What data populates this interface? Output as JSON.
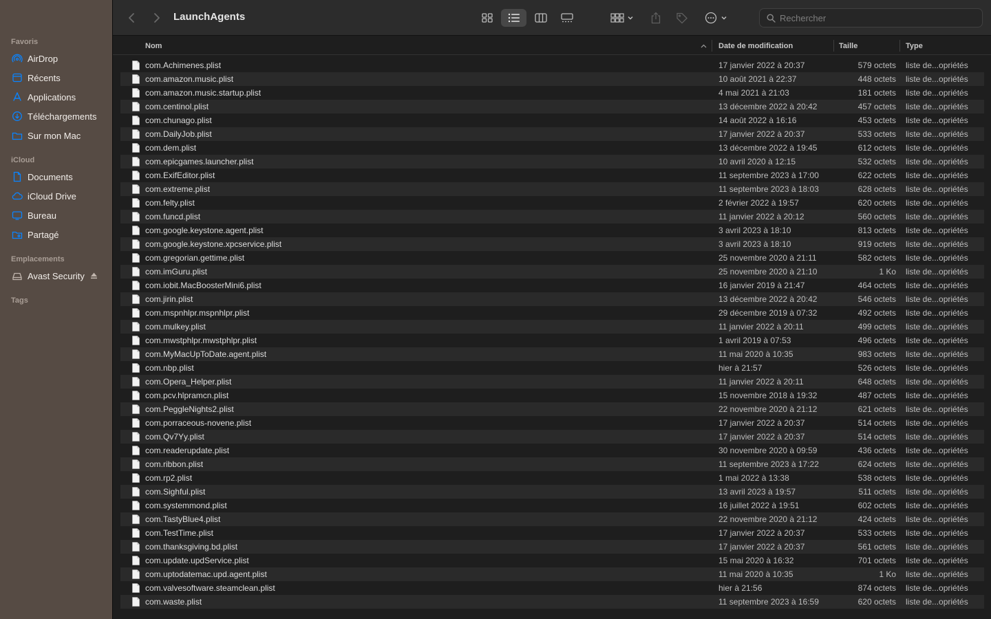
{
  "window": {
    "title": "LaunchAgents"
  },
  "toolbar": {
    "back_icon": "chevron-left-icon",
    "forward_icon": "chevron-right-icon",
    "views": [
      "icon-view",
      "list-view",
      "column-view",
      "gallery-view"
    ],
    "active_view": "list-view"
  },
  "search": {
    "placeholder": "Rechercher",
    "value": ""
  },
  "sidebar": {
    "sections": [
      {
        "label": "Favoris",
        "items": [
          {
            "label": "AirDrop",
            "icon": "airdrop-icon"
          },
          {
            "label": "Récents",
            "icon": "recents-icon"
          },
          {
            "label": "Applications",
            "icon": "applications-icon"
          },
          {
            "label": "Téléchargements",
            "icon": "downloads-icon"
          },
          {
            "label": "Sur mon Mac",
            "icon": "folder-icon"
          }
        ]
      },
      {
        "label": "iCloud",
        "items": [
          {
            "label": "Documents",
            "icon": "document-icon"
          },
          {
            "label": "iCloud Drive",
            "icon": "cloud-icon"
          },
          {
            "label": "Bureau",
            "icon": "desktop-icon"
          },
          {
            "label": "Partagé",
            "icon": "shared-folder-icon"
          }
        ]
      },
      {
        "label": "Emplacements",
        "items": [
          {
            "label": "Avast Security",
            "icon": "disk-icon"
          }
        ]
      },
      {
        "label": "Tags",
        "items": []
      }
    ]
  },
  "columns": {
    "name": "Nom",
    "date": "Date de modification",
    "size": "Taille",
    "type": "Type"
  },
  "colors": {
    "sidebar_bg": "#564b44",
    "accent": "#0a84ff"
  },
  "files": [
    {
      "name": "com.Achimenes.plist",
      "date": "17 janvier 2022 à 20:37",
      "size": "579 octets",
      "type": "liste de...opriétés"
    },
    {
      "name": "com.amazon.music.plist",
      "date": "10 août 2021 à 22:37",
      "size": "448 octets",
      "type": "liste de...opriétés"
    },
    {
      "name": "com.amazon.music.startup.plist",
      "date": "4 mai 2021 à 21:03",
      "size": "181 octets",
      "type": "liste de...opriétés"
    },
    {
      "name": "com.centinol.plist",
      "date": "13 décembre 2022 à 20:42",
      "size": "457 octets",
      "type": "liste de...opriétés"
    },
    {
      "name": "com.chunago.plist",
      "date": "14 août 2022 à 16:16",
      "size": "453 octets",
      "type": "liste de...opriétés"
    },
    {
      "name": "com.DailyJob.plist",
      "date": "17 janvier 2022 à 20:37",
      "size": "533 octets",
      "type": "liste de...opriétés"
    },
    {
      "name": "com.dem.plist",
      "date": "13 décembre 2022 à 19:45",
      "size": "612 octets",
      "type": "liste de...opriétés"
    },
    {
      "name": "com.epicgames.launcher.plist",
      "date": "10 avril 2020 à 12:15",
      "size": "532 octets",
      "type": "liste de...opriétés"
    },
    {
      "name": "com.ExifEditor.plist",
      "date": "11 septembre 2023 à 17:00",
      "size": "622 octets",
      "type": "liste de...opriétés"
    },
    {
      "name": "com.extreme.plist",
      "date": "11 septembre 2023 à 18:03",
      "size": "628 octets",
      "type": "liste de...opriétés"
    },
    {
      "name": "com.felty.plist",
      "date": "2 février 2022 à 19:57",
      "size": "620 octets",
      "type": "liste de...opriétés"
    },
    {
      "name": "com.funcd.plist",
      "date": "11 janvier 2022 à 20:12",
      "size": "560 octets",
      "type": "liste de...opriétés"
    },
    {
      "name": "com.google.keystone.agent.plist",
      "date": "3 avril 2023 à 18:10",
      "size": "813 octets",
      "type": "liste de...opriétés"
    },
    {
      "name": "com.google.keystone.xpcservice.plist",
      "date": "3 avril 2023 à 18:10",
      "size": "919 octets",
      "type": "liste de...opriétés"
    },
    {
      "name": "com.gregorian.gettime.plist",
      "date": "25 novembre 2020 à 21:11",
      "size": "582 octets",
      "type": "liste de...opriétés"
    },
    {
      "name": "com.imGuru.plist",
      "date": "25 novembre 2020 à 21:10",
      "size": "1 Ko",
      "type": "liste de...opriétés"
    },
    {
      "name": "com.iobit.MacBoosterMini6.plist",
      "date": "16 janvier 2019 à 21:47",
      "size": "464 octets",
      "type": "liste de...opriétés"
    },
    {
      "name": "com.jirin.plist",
      "date": "13 décembre 2022 à 20:42",
      "size": "546 octets",
      "type": "liste de...opriétés"
    },
    {
      "name": "com.mspnhlpr.mspnhlpr.plist",
      "date": "29 décembre 2019 à 07:32",
      "size": "492 octets",
      "type": "liste de...opriétés"
    },
    {
      "name": "com.mulkey.plist",
      "date": "11 janvier 2022 à 20:11",
      "size": "499 octets",
      "type": "liste de...opriétés"
    },
    {
      "name": "com.mwstphlpr.mwstphlpr.plist",
      "date": "1 avril 2019 à 07:53",
      "size": "496 octets",
      "type": "liste de...opriétés"
    },
    {
      "name": "com.MyMacUpToDate.agent.plist",
      "date": "11 mai 2020 à 10:35",
      "size": "983 octets",
      "type": "liste de...opriétés"
    },
    {
      "name": "com.nbp.plist",
      "date": "hier à 21:57",
      "size": "526 octets",
      "type": "liste de...opriétés"
    },
    {
      "name": "com.Opera_Helper.plist",
      "date": "11 janvier 2022 à 20:11",
      "size": "648 octets",
      "type": "liste de...opriétés"
    },
    {
      "name": "com.pcv.hlpramcn.plist",
      "date": "15 novembre 2018 à 19:32",
      "size": "487 octets",
      "type": "liste de...opriétés"
    },
    {
      "name": "com.PeggleNights2.plist",
      "date": "22 novembre 2020 à 21:12",
      "size": "621 octets",
      "type": "liste de...opriétés"
    },
    {
      "name": "com.porraceous-novene.plist",
      "date": "17 janvier 2022 à 20:37",
      "size": "514 octets",
      "type": "liste de...opriétés"
    },
    {
      "name": "com.Qv7Yy.plist",
      "date": "17 janvier 2022 à 20:37",
      "size": "514 octets",
      "type": "liste de...opriétés"
    },
    {
      "name": "com.readerupdate.plist",
      "date": "30 novembre 2020 à 09:59",
      "size": "436 octets",
      "type": "liste de...opriétés"
    },
    {
      "name": "com.ribbon.plist",
      "date": "11 septembre 2023 à 17:22",
      "size": "624 octets",
      "type": "liste de...opriétés"
    },
    {
      "name": "com.rp2.plist",
      "date": "1 mai 2022 à 13:38",
      "size": "538 octets",
      "type": "liste de...opriétés"
    },
    {
      "name": "com.Sighful.plist",
      "date": "13 avril 2023 à 19:57",
      "size": "511 octets",
      "type": "liste de...opriétés"
    },
    {
      "name": "com.systemmond.plist",
      "date": "16 juillet 2022 à 19:51",
      "size": "602 octets",
      "type": "liste de...opriétés"
    },
    {
      "name": "com.TastyBlue4.plist",
      "date": "22 novembre 2020 à 21:12",
      "size": "424 octets",
      "type": "liste de...opriétés"
    },
    {
      "name": "com.TestTime.plist",
      "date": "17 janvier 2022 à 20:37",
      "size": "533 octets",
      "type": "liste de...opriétés"
    },
    {
      "name": "com.thanksgiving.bd.plist",
      "date": "17 janvier 2022 à 20:37",
      "size": "561 octets",
      "type": "liste de...opriétés"
    },
    {
      "name": "com.update.updService.plist",
      "date": "15 mai 2020 à 16:32",
      "size": "701 octets",
      "type": "liste de...opriétés"
    },
    {
      "name": "com.uptodatemac.upd.agent.plist",
      "date": "11 mai 2020 à 10:35",
      "size": "1 Ko",
      "type": "liste de...opriétés"
    },
    {
      "name": "com.valvesoftware.steamclean.plist",
      "date": "hier à 21:56",
      "size": "874 octets",
      "type": "liste de...opriétés"
    },
    {
      "name": "com.waste.plist",
      "date": "11 septembre 2023 à 16:59",
      "size": "620 octets",
      "type": "liste de...opriétés"
    }
  ]
}
